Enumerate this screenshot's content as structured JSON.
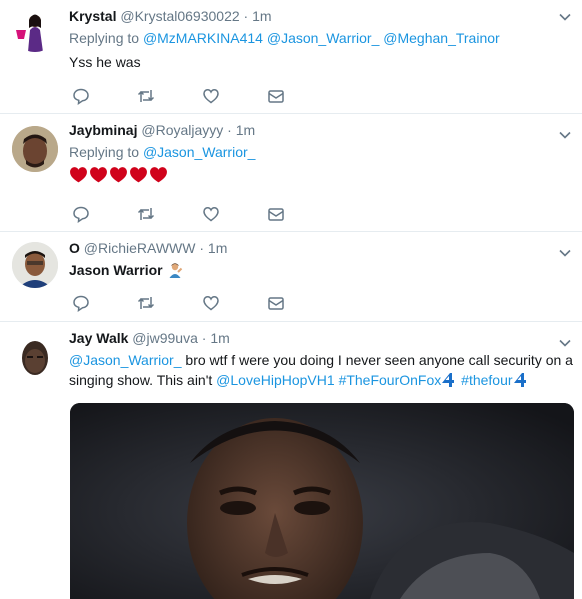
{
  "tweets": [
    {
      "name": "Krystal",
      "handle": "@Krystal06930022",
      "dot": "·",
      "time": "1m",
      "replying_label": "Replying to",
      "mentions": [
        "@MzMARKINA414",
        "@Jason_Warrior_",
        "@Meghan_Trainor"
      ],
      "text": "Yss he was"
    },
    {
      "name": "Jaybminaj",
      "handle": "@Royaljayyy",
      "dot": "·",
      "time": "1m",
      "replying_label": "Replying to",
      "mentions": [
        "@Jason_Warrior_"
      ],
      "text_emoji": "heart x5"
    },
    {
      "name": "O",
      "handle": "@RichieRAWWW",
      "dot": "·",
      "time": "1m",
      "text": "Jason Warrior"
    },
    {
      "name": "Jay Walk",
      "handle": "@jw99uva",
      "dot": "·",
      "time": "1m",
      "mention": "@Jason_Warrior_",
      "text_part1": " bro wtf f were you doing I never seen anyone call security on a singing show. This ain't ",
      "link1": "@LoveHipHopVH1",
      "hashtag1": "#TheFourOnFox",
      "hashtag2": "#thefour"
    }
  ],
  "icons": {
    "reply": "reply-icon",
    "retweet": "retweet-icon",
    "like": "heart-icon",
    "message": "envelope-icon",
    "caret": "chevron-down-icon"
  },
  "colors": {
    "link": "#1b95e0",
    "muted": "#657786",
    "heart": "#d0021b"
  }
}
